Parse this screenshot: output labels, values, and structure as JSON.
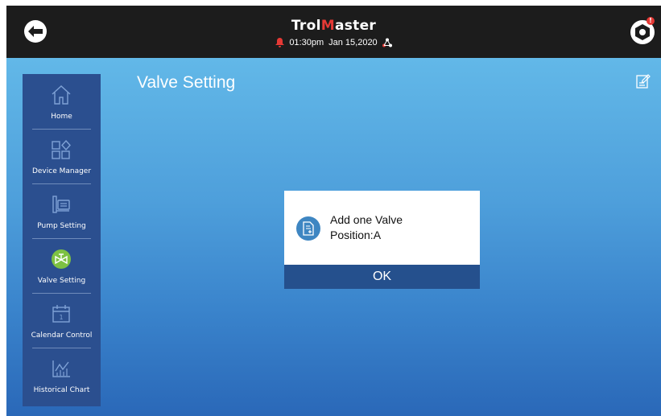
{
  "header": {
    "brand_prefix": "Trol",
    "brand_accent_letter": "M",
    "brand_suffix": "aster",
    "time": "01:30pm",
    "date": "Jan 15,2020",
    "notification_badge": "!"
  },
  "icons": {
    "back": "back-arrow-icon",
    "settings": "hexagon-settings-icon",
    "alarm": "bell-icon",
    "network": "network-icon",
    "edit": "edit-note-icon",
    "dialog": "document-add-icon"
  },
  "sidebar": {
    "items": [
      {
        "label": "Home",
        "icon": "home-icon",
        "active": false
      },
      {
        "label": "Device Manager",
        "icon": "device-grid-icon",
        "active": false
      },
      {
        "label": "Pump Setting",
        "icon": "pump-icon",
        "active": false
      },
      {
        "label": "Valve Setting",
        "icon": "valve-icon",
        "active": true
      },
      {
        "label": "Calendar Control",
        "icon": "calendar-icon",
        "active": false
      },
      {
        "label": "Historical Chart",
        "icon": "chart-icon",
        "active": false
      }
    ]
  },
  "main": {
    "title": "Valve Setting"
  },
  "dialog": {
    "line1": "Add one Valve",
    "line2": "Position:A",
    "ok_label": "OK"
  },
  "colors": {
    "brand_accent": "#e53935",
    "sidebar_bg": "#2b4f8f",
    "active_icon": "#7dc142",
    "dialog_button": "#25508d"
  }
}
